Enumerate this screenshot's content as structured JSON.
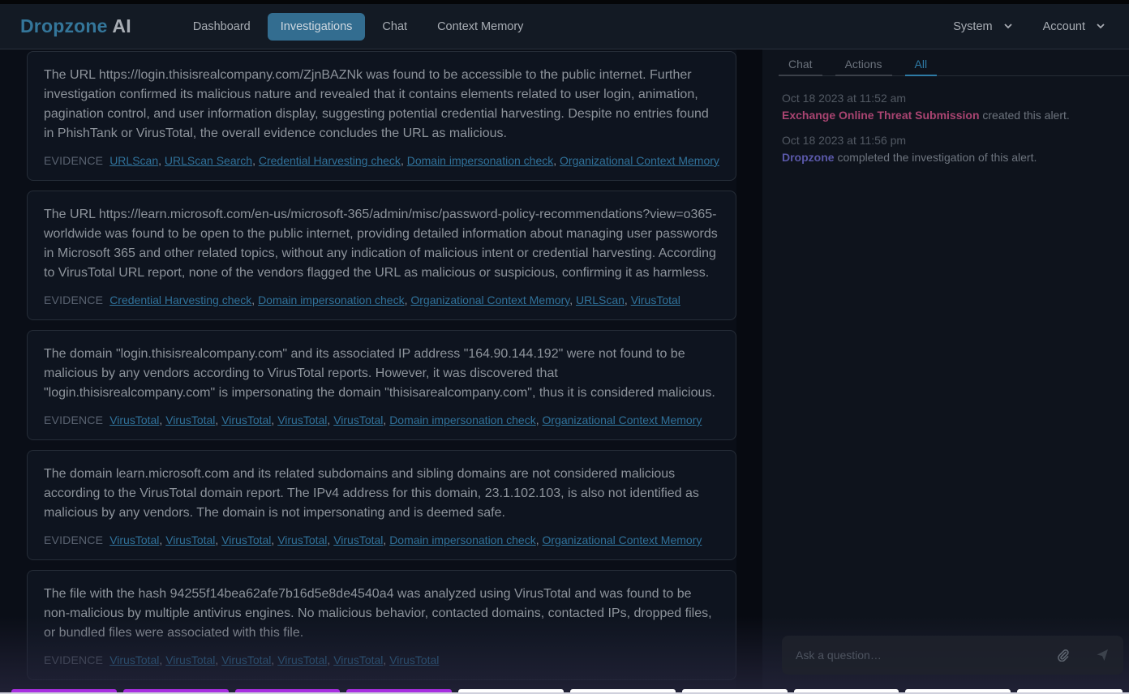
{
  "brand": {
    "part1": "Dropzone",
    "part2": "AI"
  },
  "nav": {
    "links": [
      {
        "label": "Dashboard",
        "active": false
      },
      {
        "label": "Investigations",
        "active": true
      },
      {
        "label": "Chat",
        "active": false
      },
      {
        "label": "Context Memory",
        "active": false
      }
    ],
    "dropdowns": [
      {
        "label": "System",
        "icon": "chevron-down-icon"
      },
      {
        "label": "Account",
        "icon": "chevron-down-icon"
      }
    ]
  },
  "findings": [
    {
      "text": "The URL https://login.thisisrealcompany.com/ZjnBAZNk was found to be accessible to the public internet. Further investigation confirmed its malicious nature and revealed that it contains elements related to user login, animation, pagination control, and user information display, suggesting potential credential harvesting. Despite no entries found in PhishTank or VirusTotal, the overall evidence concludes the URL as malicious.",
      "evidence_label": "EVIDENCE",
      "evidence": [
        "URLScan",
        "URLScan Search",
        "Credential Harvesting check",
        "Domain impersonation check",
        "Organizational Context Memory"
      ]
    },
    {
      "text": "The URL https://learn.microsoft.com/en-us/microsoft-365/admin/misc/password-policy-recommendations?view=o365-worldwide was found to be open to the public internet, providing detailed information about managing user passwords in Microsoft 365 and other related topics, without any indication of malicious intent or credential harvesting. According to VirusTotal URL report, none of the vendors flagged the URL as malicious or suspicious, confirming it as harmless.",
      "evidence_label": "EVIDENCE",
      "evidence": [
        "Credential Harvesting check",
        "Domain impersonation check",
        "Organizational Context Memory",
        "URLScan",
        "VirusTotal"
      ]
    },
    {
      "text": "The domain \"login.thisisrealcompany.com\" and its associated IP address \"164.90.144.192\" were not found to be malicious by any vendors according to VirusTotal reports. However, it was discovered that \"login.thisisrealcompany.com\" is impersonating the domain \"thisisarealcompany.com\", thus it is considered malicious.",
      "evidence_label": "EVIDENCE",
      "evidence": [
        "VirusTotal",
        "VirusTotal",
        "VirusTotal",
        "VirusTotal",
        "VirusTotal",
        "Domain impersonation check",
        "Organizational Context Memory"
      ]
    },
    {
      "text": "The domain learn.microsoft.com and its related subdomains and sibling domains are not considered malicious according to the VirusTotal domain report. The IPv4 address for this domain, 23.1.102.103, is also not identified as malicious by any vendors. The domain is not impersonating and is deemed safe.",
      "evidence_label": "EVIDENCE",
      "evidence": [
        "VirusTotal",
        "VirusTotal",
        "VirusTotal",
        "VirusTotal",
        "VirusTotal",
        "Domain impersonation check",
        "Organizational Context Memory"
      ]
    },
    {
      "text": "The file with the hash 94255f14bea62afe7b16d5e8de4540a4 was analyzed using VirusTotal and was found to be non-malicious by multiple antivirus engines. No malicious behavior, contacted domains, contacted IPs, dropped files, or bundled files were associated with this file.",
      "evidence_label": "EVIDENCE",
      "evidence": [
        "VirusTotal",
        "VirusTotal",
        "VirusTotal",
        "VirusTotal",
        "VirusTotal",
        "VirusTotal"
      ]
    }
  ],
  "activity": {
    "tabs": [
      {
        "label": "Chat",
        "active": false
      },
      {
        "label": "Actions",
        "active": false
      },
      {
        "label": "All",
        "active": true
      }
    ],
    "events": [
      {
        "time": "Oct 18 2023 at 11:52 am",
        "actor": "Exchange Online Threat Submission",
        "actor_color": "#a94471",
        "message": " created this alert."
      },
      {
        "time": "Oct 18 2023 at 11:56 pm",
        "actor": "Dropzone",
        "actor_color": "#5a58a9",
        "message": " completed the investigation of this alert."
      }
    ],
    "ask": {
      "placeholder": "Ask a question…",
      "attach_icon": "paperclip-icon",
      "send_icon": "send-icon"
    }
  },
  "progress": {
    "completed_steps": 4,
    "total_steps": 10,
    "color_done": "#a82fe0",
    "color_pending": "#ffffff"
  }
}
